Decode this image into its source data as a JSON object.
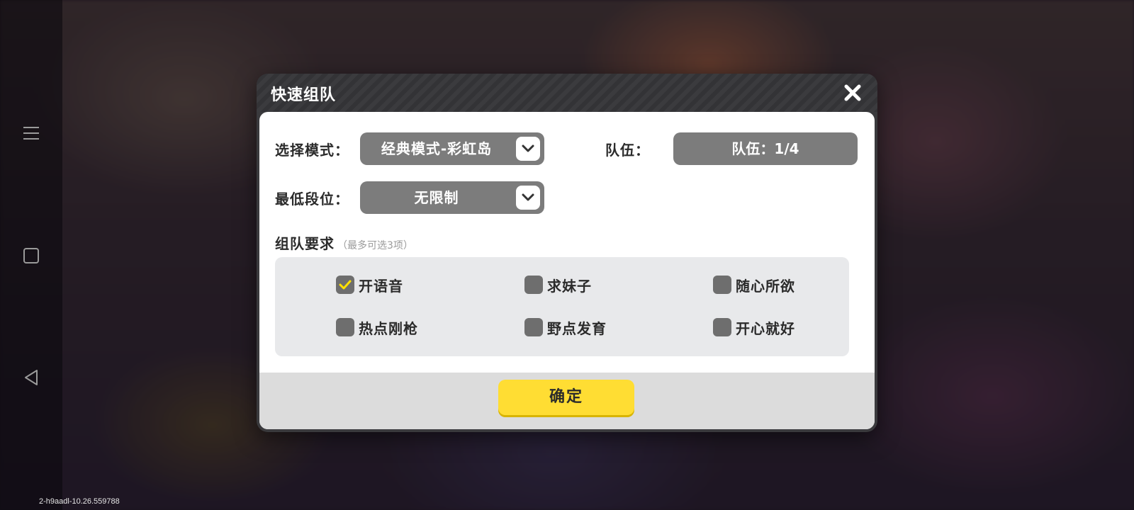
{
  "dialog": {
    "title": "快速组队",
    "close_icon": "close-icon"
  },
  "mode": {
    "label": "选择模式：",
    "value": "经典模式-彩虹岛"
  },
  "team": {
    "label": "队伍：",
    "value": "队伍：1/4"
  },
  "rank": {
    "label": "最低段位：",
    "value": "无限制"
  },
  "requirements": {
    "title": "组队要求",
    "hint": "（最多可选3项）",
    "options": [
      {
        "label": "开语音",
        "checked": true
      },
      {
        "label": "求妹子",
        "checked": false
      },
      {
        "label": "随心所欲",
        "checked": false
      },
      {
        "label": "热点刚枪",
        "checked": false
      },
      {
        "label": "野点发育",
        "checked": false
      },
      {
        "label": "开心就好",
        "checked": false
      }
    ]
  },
  "confirm_label": "确定",
  "version_text": "2-h9aadl-10.26.559788",
  "colors": {
    "accent": "#ffdd33",
    "check_mark": "#ffe000",
    "select_bg": "#7c7c7c"
  }
}
